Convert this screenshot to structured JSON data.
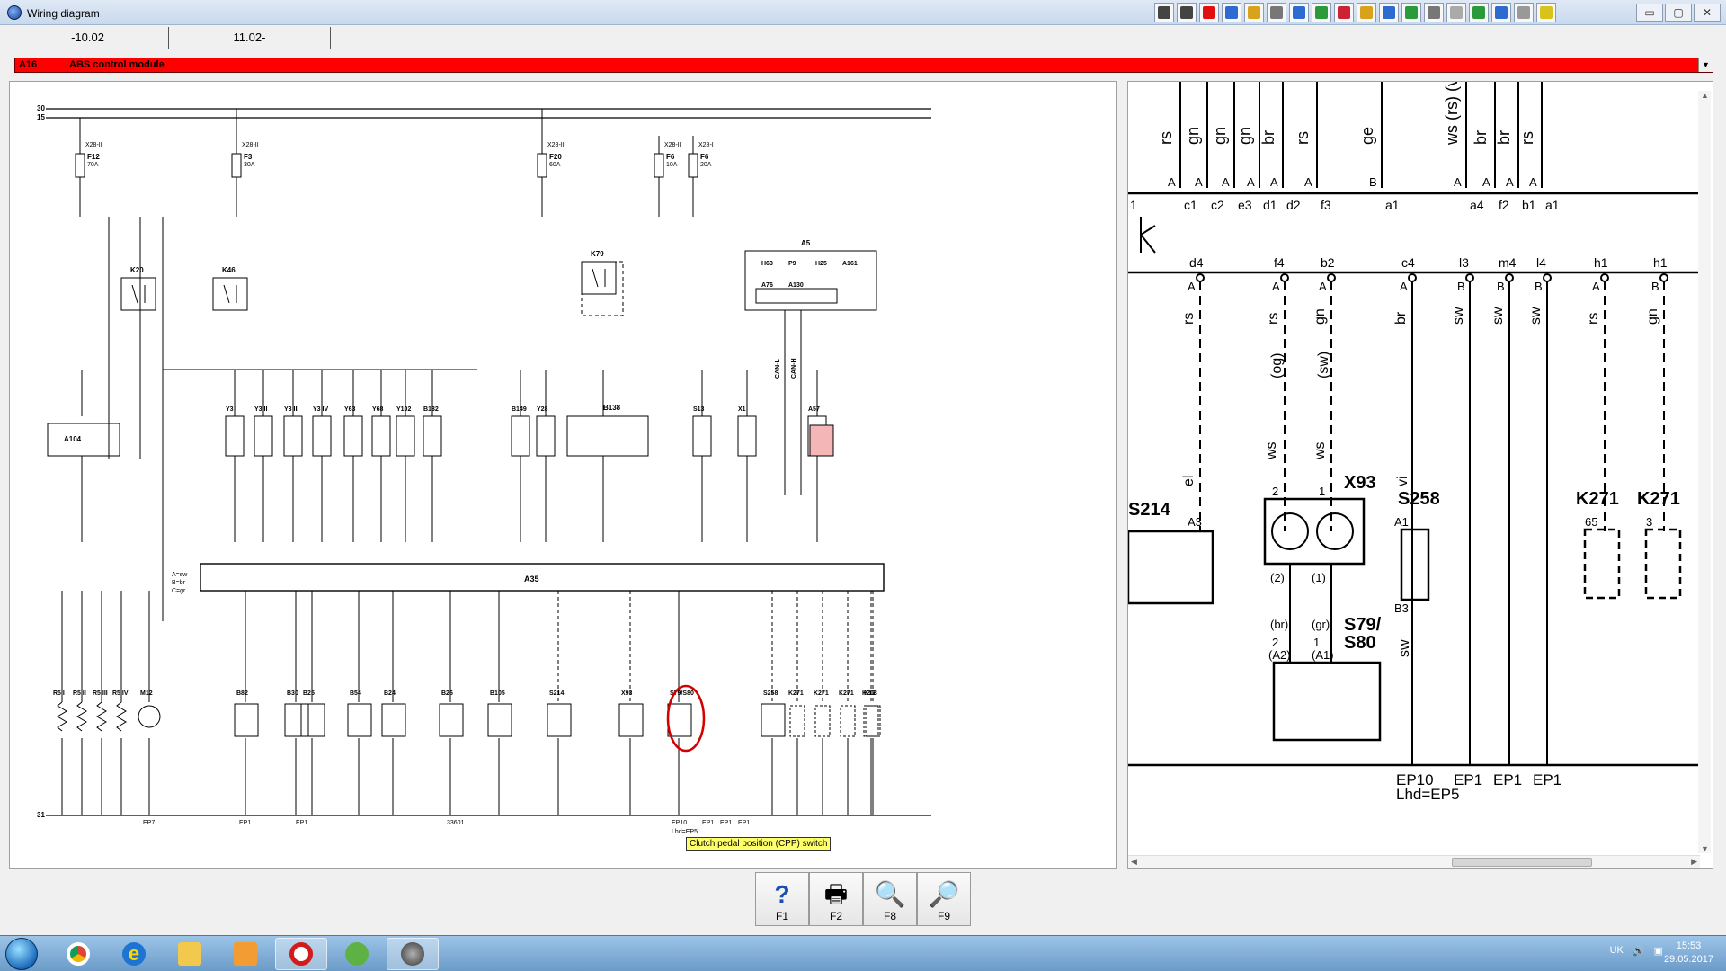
{
  "window": {
    "title": "Wiring diagram"
  },
  "toolbar": {
    "icons": [
      "nav-first-icon",
      "nav-prev-icon",
      "warning-icon",
      "document-icon",
      "folder-icon",
      "settings-icon",
      "book-icon",
      "gauge-icon",
      "chart-icon",
      "car-icon",
      "tool-icon",
      "engine-icon",
      "list-icon",
      "print-icon",
      "wrench-icon",
      "info-icon",
      "help-icon",
      "note-icon"
    ],
    "window_buttons": {
      "minimize": "▭",
      "maximize": "▢",
      "close": "✕"
    }
  },
  "version_tabs": [
    "-10.02",
    "11.02-"
  ],
  "module": {
    "code": "A16",
    "name": "ABS control module",
    "dropdown": "▼"
  },
  "tooltip": "Clutch pedal position (CPP) switch",
  "left_diagram": {
    "bus_labels": [
      "30",
      "15",
      "31"
    ],
    "fuses": [
      {
        "conn": "X28-II",
        "name": "F12",
        "rating": "70A"
      },
      {
        "conn": "X28-II",
        "name": "F3",
        "rating": "30A"
      },
      {
        "conn": "X28-II",
        "name": "F20",
        "rating": "60A"
      },
      {
        "conn": "X28-II",
        "name": "F6",
        "rating": "10A"
      },
      {
        "conn": "X28-I",
        "name": "F6",
        "rating": "20A"
      }
    ],
    "relays": [
      "K20",
      "K46",
      "K79"
    ],
    "top_components": [
      "A104",
      "Y3 I",
      "Y3 II",
      "Y3 III",
      "Y3 IV",
      "Y63",
      "Y68",
      "Y102",
      "B132",
      "B149",
      "Y28",
      "B138",
      "S13",
      "X1",
      "A57"
    ],
    "a5_box": {
      "name": "A5",
      "parts": [
        "H63",
        "P9",
        "H25",
        "A161",
        "A76",
        "A130"
      ]
    },
    "can_labels": [
      "CAN-L",
      "CAN-H"
    ],
    "module_label": "A35",
    "legend": [
      "A=sw",
      "B=br",
      "C=gr"
    ],
    "bottom_components": [
      "R5 I",
      "R5 II",
      "R5 III",
      "R5 IV",
      "M12",
      "B82",
      "B30",
      "B25",
      "B54",
      "B24",
      "B26",
      "B105",
      "S214",
      "X93",
      "S79/S80",
      "S258",
      "K271",
      "K271",
      "K271",
      "K12",
      "K208"
    ],
    "ground_labels": [
      "EP7",
      "EP1",
      "EP1",
      "33601",
      "EP10",
      "Lhd=EP5",
      "EP1",
      "EP1",
      "EP1"
    ]
  },
  "right_diagram": {
    "top_wires": [
      "rs",
      "gn",
      "gn",
      "gn",
      "br",
      "rs",
      "ge",
      "ws (rs) (vi) (",
      "br",
      "br",
      "rs"
    ],
    "top_pin_letters": [
      "A",
      "A",
      "A",
      "A",
      "A",
      "A",
      "B",
      "A",
      "A",
      "A",
      "A"
    ],
    "top_pins": [
      "1",
      "c1",
      "c2",
      "e3",
      "d1",
      "d2",
      "f3",
      "a1",
      "a4",
      "f2",
      "b1",
      "a1"
    ],
    "mid_pins": [
      "d4",
      "f4",
      "b2",
      "c4",
      "l3",
      "m4",
      "l4",
      "h1",
      "h1"
    ],
    "mid_letters": [
      "A",
      "A",
      "A",
      "A",
      "B",
      "B",
      "B",
      "A",
      "B"
    ],
    "mid_wires": [
      "rs",
      "rs",
      "gn",
      "br",
      "sw",
      "sw",
      "sw",
      "rs",
      "gn"
    ],
    "mid_wires_paren": [
      "(og)",
      "(sw)"
    ],
    "lower_wires": [
      "el",
      "ws",
      "ws",
      "vi",
      "sw"
    ],
    "components": [
      "S214",
      "X93",
      "S258",
      "K271",
      "K271",
      "S79/",
      "S80"
    ],
    "pin_numbers": [
      "A3",
      "2",
      "1",
      "A1",
      "B3",
      "65",
      "3",
      "(2)",
      "(1)",
      "(br)",
      "(gr)",
      "2",
      "1",
      "(A2)",
      "(A1)"
    ],
    "grounds": [
      "EP10",
      "Lhd=EP5",
      "EP1",
      "EP1",
      "EP1"
    ]
  },
  "fkeys": [
    {
      "label": "F1",
      "icon": "help-icon",
      "glyph": "?"
    },
    {
      "label": "F2",
      "icon": "print-icon",
      "glyph": "🖶"
    },
    {
      "label": "F8",
      "icon": "zoom-text-icon",
      "glyph": "🔍"
    },
    {
      "label": "F9",
      "icon": "zoom-icon",
      "glyph": "🔎"
    }
  ],
  "taskbar": {
    "apps": [
      "chrome-icon",
      "ie-icon",
      "explorer-icon",
      "media-player-icon",
      "opera-icon",
      "utorrent-icon",
      "wis-app-icon"
    ],
    "lang": "UK",
    "time": "15:53",
    "date": "29.05.2017"
  }
}
